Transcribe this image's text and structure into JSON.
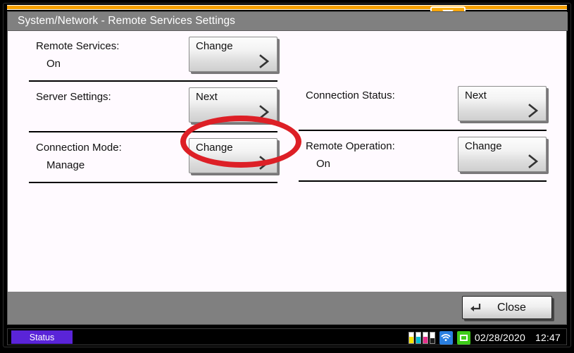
{
  "window": {
    "title": "System/Network - Remote Services Settings",
    "pulldown_tab_icon": "chevron-down-icon"
  },
  "settings": {
    "left_column": [
      {
        "label": "Remote Services:",
        "value": "On",
        "button_label": "Change",
        "button_icon": "chevron-right-icon"
      },
      {
        "label": "Server Settings:",
        "value": "",
        "button_label": "Next",
        "button_icon": "chevron-right-icon",
        "highlighted": true
      },
      {
        "label": "Connection Mode:",
        "value": "Manage",
        "button_label": "Change",
        "button_icon": "chevron-right-icon"
      }
    ],
    "right_column": [
      {
        "label": "Connection Status:",
        "value": "",
        "button_label": "Next",
        "button_icon": "chevron-right-icon"
      },
      {
        "label": "Remote Operation:",
        "value": "On",
        "button_label": "Change",
        "button_icon": "chevron-right-icon"
      }
    ]
  },
  "footer": {
    "close_label": "Close",
    "close_icon": "enter-key-icon"
  },
  "statusbar": {
    "status_label": "Status",
    "date": "02/28/2020",
    "time": "12:47",
    "toner": [
      {
        "name": "toner-yellow",
        "color": "#f5e400",
        "level": 55
      },
      {
        "name": "toner-cyan",
        "color": "#00bcd4",
        "level": 55
      },
      {
        "name": "toner-magenta",
        "color": "#e62f8b",
        "level": 55
      },
      {
        "name": "toner-black",
        "color": "#1a1a1a",
        "level": 45
      }
    ],
    "wifi_icon": "wifi-icon",
    "screen_icon": "display-icon"
  },
  "annotation": {
    "type": "ellipse-highlight",
    "color": "#dd1f26",
    "target": "Next"
  },
  "colors": {
    "accent_orange": "#f5a000",
    "titlebar_gray": "#808080",
    "panel_bg": "#fffaff",
    "status_purple": "#5a24d8",
    "annotation_red": "#dd1f26"
  }
}
